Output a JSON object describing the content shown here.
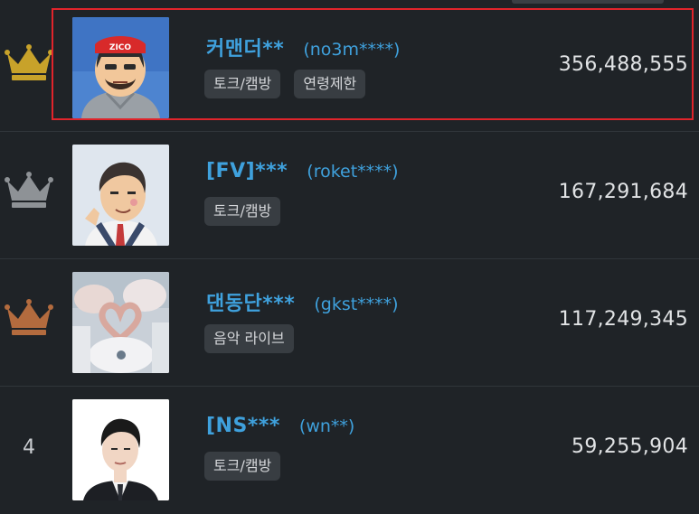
{
  "rankings": [
    {
      "rank": "1",
      "crown_icon": "gold-crown-icon",
      "crown_color": "#c8a22a",
      "nickname": "커맨더**",
      "user_id": "(no3m****)",
      "tags": [
        "토크/캠방",
        "연령제한"
      ],
      "amount": "356,488,555",
      "avatar_icon": "cartoon-man-headband-avatar",
      "highlighted": true
    },
    {
      "rank": "2",
      "crown_icon": "silver-crown-icon",
      "crown_color": "#8e9296",
      "nickname": "[FV]***",
      "user_id": "(roket****)",
      "tags": [
        "토크/캠방"
      ],
      "amount": "167,291,684",
      "avatar_icon": "cartoon-man-suit-avatar"
    },
    {
      "rank": "3",
      "crown_icon": "bronze-crown-icon",
      "crown_color": "#b36b3e",
      "nickname": "댄동단***",
      "user_id": "(gkst****)",
      "tags": [
        "음악 라이브"
      ],
      "amount": "117,249,345",
      "avatar_icon": "heart-hands-photo-avatar"
    },
    {
      "rank": "4",
      "nickname": "[NS***",
      "user_id": "(wn**)",
      "tags": [
        "토크/캠방"
      ],
      "amount": "59,255,904",
      "avatar_icon": "man-portrait-photo-avatar"
    }
  ],
  "highlight_color": "#e0242b",
  "accent_color": "#3fa1dd"
}
